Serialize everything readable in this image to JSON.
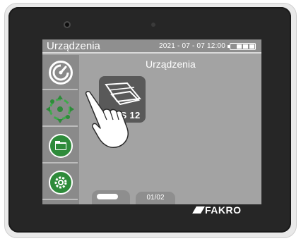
{
  "header": {
    "title": "Urządzenia",
    "datetime": "2021 - 07 - 07  12:00",
    "battery_icon": "battery-icon"
  },
  "sidebar": {
    "items": [
      {
        "icon": "devices-icon"
      },
      {
        "icon": "scenes-icon"
      },
      {
        "icon": "folder-icon"
      },
      {
        "icon": "settings-gear-icon"
      }
    ]
  },
  "main": {
    "title": "Urządzenia",
    "device_tile": {
      "label": "WS 12",
      "icon": "roof-window-icon"
    }
  },
  "pager": {
    "current_indicator": "page-indicator",
    "page_label": "01/02"
  },
  "brand": {
    "name": "FAKRO"
  },
  "colors": {
    "screen_bg": "#a3a3a3",
    "bar_bg": "#8f8f8f",
    "accent_green": "#2e8b3a",
    "device_body": "#262626"
  }
}
